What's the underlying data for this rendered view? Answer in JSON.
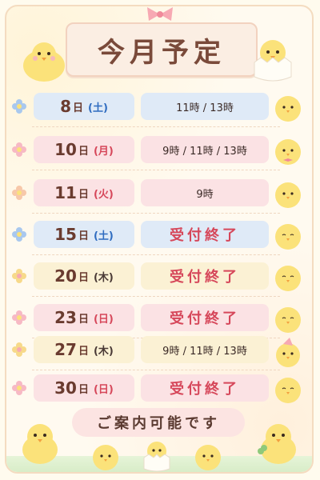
{
  "title": "今月予定",
  "footer": "ご案内可能です",
  "schedule": [
    {
      "day": "8",
      "suffix": "日",
      "dow": "(土)",
      "dow_color": "blue",
      "times": "11時 / 13時",
      "closed": false,
      "date_bg": "blue"
    },
    {
      "day": "10",
      "suffix": "日",
      "dow": "(月)",
      "dow_color": "red",
      "times": "9時 / 11時 / 13時",
      "closed": false,
      "date_bg": "pink"
    },
    {
      "day": "11",
      "suffix": "日",
      "dow": "(火)",
      "dow_color": "red",
      "times": "9時",
      "closed": false,
      "date_bg": "pink"
    },
    {
      "day": "15",
      "suffix": "日",
      "dow": "(土)",
      "dow_color": "blue",
      "times": "受付終了",
      "closed": true,
      "date_bg": "blue"
    },
    {
      "day": "20",
      "suffix": "日",
      "dow": "(木)",
      "dow_color": "dark",
      "times": "受付終了",
      "closed": true,
      "date_bg": "yellow"
    },
    {
      "day": "23",
      "suffix": "日",
      "dow": "(日)",
      "dow_color": "red",
      "times": "受付終了",
      "closed": true,
      "date_bg": "pink"
    },
    {
      "day": "27",
      "suffix": "日",
      "dow": "(木)",
      "dow_color": "dark",
      "times": "9時 / 11時 / 13時",
      "closed": false,
      "date_bg": "yellow"
    },
    {
      "day": "30",
      "suffix": "日",
      "dow": "(日)",
      "dow_color": "red",
      "times": "受付終了",
      "closed": true,
      "date_bg": "pink"
    }
  ],
  "colors": {
    "blue": "#dfeaf7",
    "pink": "#fbe2e4",
    "yellow": "#fbf1d4",
    "closed_text": "#d6475a",
    "chick": "#fbe27a"
  }
}
